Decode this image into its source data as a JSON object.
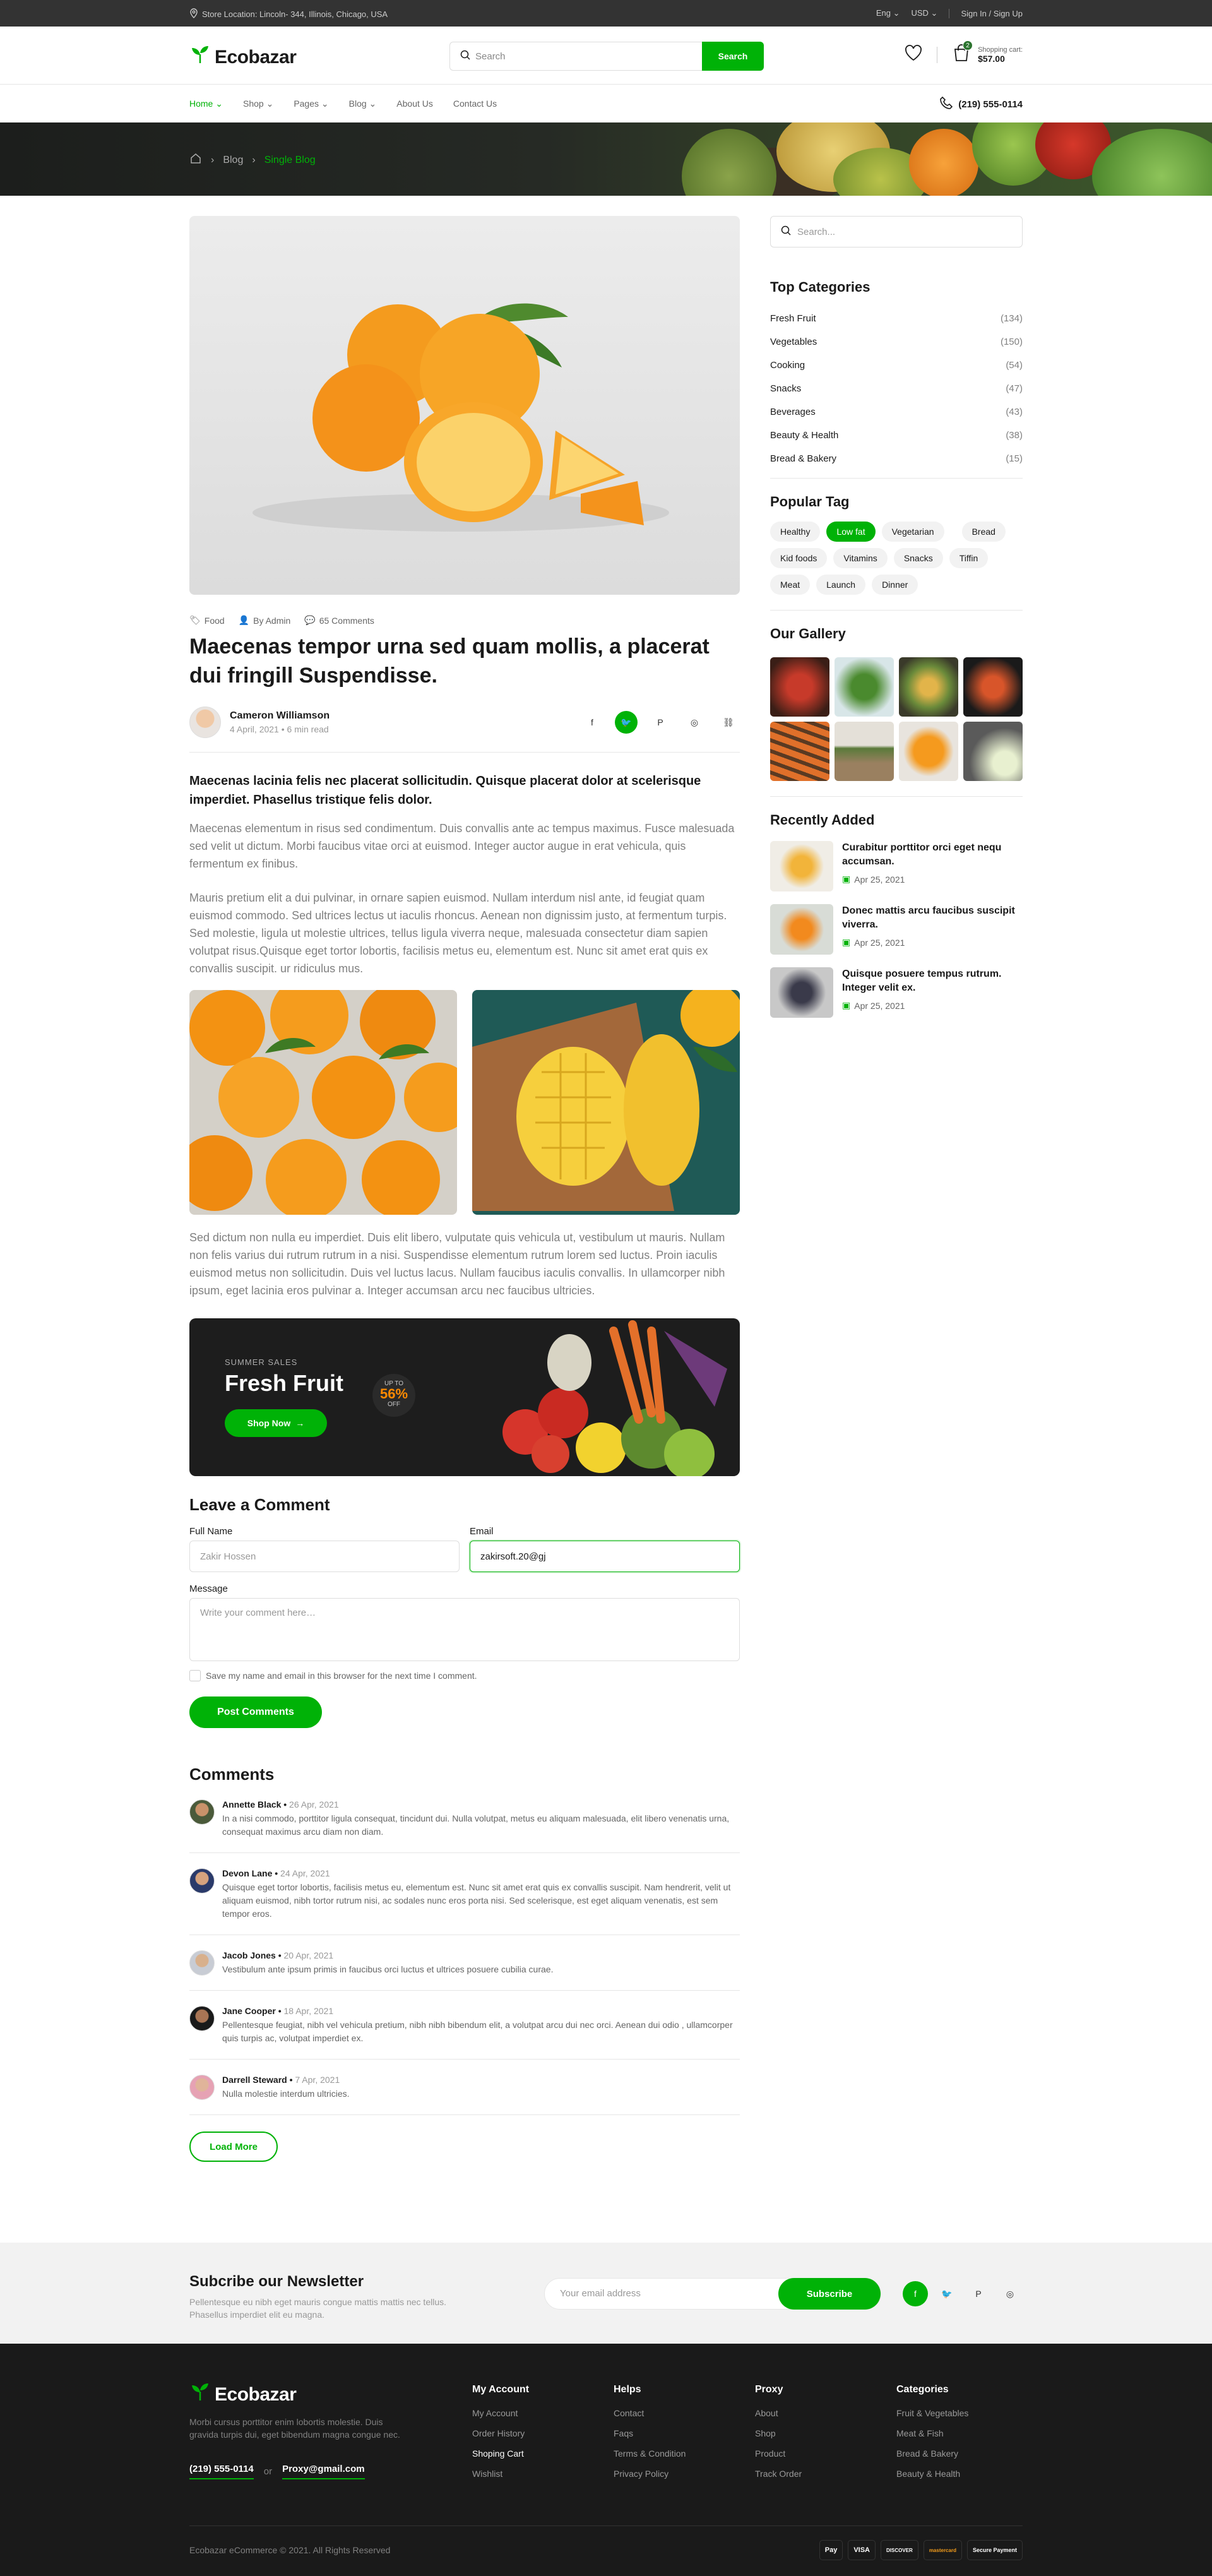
{
  "topbar": {
    "location": "Store Location: Lincoln- 344, Illinois, Chicago, USA",
    "lang": "Eng",
    "currency": "USD",
    "auth": "Sign In / Sign Up"
  },
  "header": {
    "logo": "Ecobazar",
    "search_placeholder": "Search",
    "search_button": "Search",
    "cart_label": "Shopping cart:",
    "cart_value": "$57.00",
    "cart_count": "2"
  },
  "nav": {
    "items": [
      "Home",
      "Shop",
      "Pages",
      "Blog",
      "About Us",
      "Contact Us"
    ],
    "phone": "(219) 555-0114"
  },
  "breadcrumb": {
    "items": [
      "Blog",
      "Single Blog"
    ]
  },
  "post": {
    "category": "Food",
    "author_meta": "By Admin",
    "comments_count": "65 Comments",
    "title": "Maecenas tempor urna sed quam mollis, a placerat dui fringill Suspendisse.",
    "author": "Cameron Williamson",
    "date": "4 April, 2021",
    "read_time": "6 min read",
    "lead": "Maecenas lacinia felis nec placerat sollicitudin. Quisque placerat dolor at scelerisque imperdiet. Phasellus tristique felis dolor.",
    "para1": "Maecenas elementum in risus sed condimentum. Duis convallis ante ac tempus maximus. Fusce malesuada sed velit ut dictum. Morbi faucibus vitae orci at euismod. Integer auctor augue in erat vehicula, quis fermentum ex finibus.",
    "para2": "Mauris pretium elit a dui pulvinar, in ornare sapien euismod. Nullam interdum nisl ante, id feugiat quam euismod commodo. Sed ultrices lectus ut iaculis rhoncus. Aenean non dignissim justo, at fermentum turpis. Sed molestie, ligula ut molestie ultrices, tellus ligula viverra neque, malesuada consectetur diam sapien volutpat risus.Quisque eget tortor lobortis, facilisis metus eu, elementum est. Nunc sit amet erat quis ex convallis suscipit. ur ridiculus mus.",
    "para3": "Sed dictum non nulla eu imperdiet. Duis elit libero, vulputate quis vehicula ut, vestibulum ut mauris. Nullam non felis varius dui rutrum rutrum in a nisi. Suspendisse elementum rutrum lorem sed luctus. Proin iaculis euismod metus non sollicitudin. Duis vel luctus lacus. Nullam faucibus iaculis convallis. In ullamcorper nibh ipsum, eget lacinia eros pulvinar a. Integer accumsan arcu nec faucibus ultricies."
  },
  "promo": {
    "subtitle": "SUMMER SALES",
    "title": "Fresh Fruit",
    "button": "Shop Now",
    "up_to": "UP TO",
    "percent": "56%",
    "off": "OFF"
  },
  "comment_form": {
    "title": "Leave a Comment",
    "name_label": "Full Name",
    "name_value": "Zakir Hossen",
    "email_label": "Email",
    "email_value": "zakirsoft.20@gj",
    "message_label": "Message",
    "message_placeholder": "Write your comment here…",
    "checkbox_label": "Save my name and email in this browser for the next time I comment.",
    "submit": "Post Comments"
  },
  "comments": {
    "title": "Comments",
    "items": [
      {
        "name": "Annette Black",
        "date": "26 Apr, 2021",
        "text": "In a nisi commodo, porttitor ligula consequat, tincidunt dui. Nulla volutpat, metus eu aliquam malesuada, elit libero venenatis urna, consequat maximus arcu diam non diam."
      },
      {
        "name": "Devon Lane",
        "date": "24 Apr, 2021",
        "text": "Quisque eget tortor lobortis, facilisis metus eu, elementum est. Nunc sit amet erat quis ex convallis suscipit. Nam hendrerit, velit ut aliquam euismod, nibh tortor rutrum nisi, ac sodales nunc eros porta nisi. Sed scelerisque, est eget aliquam venenatis, est sem tempor eros."
      },
      {
        "name": "Jacob Jones",
        "date": "20 Apr, 2021",
        "text": "Vestibulum ante ipsum primis in faucibus orci luctus et ultrices posuere cubilia curae."
      },
      {
        "name": "Jane Cooper",
        "date": "18 Apr, 2021",
        "text": "Pellentesque feugiat, nibh vel vehicula pretium, nibh nibh bibendum elit, a volutpat arcu dui nec orci. Aenean dui odio , ullamcorper quis turpis ac, volutpat imperdiet ex."
      },
      {
        "name": "Darrell Steward",
        "date": "7 Apr, 2021",
        "text": "Nulla molestie interdum ultricies."
      }
    ],
    "load_more": "Load More"
  },
  "sidebar": {
    "search_placeholder": "Search...",
    "categories_title": "Top Categories",
    "categories": [
      {
        "name": "Fresh Fruit",
        "count": "(134)"
      },
      {
        "name": "Vegetables",
        "count": "(150)"
      },
      {
        "name": "Cooking",
        "count": "(54)"
      },
      {
        "name": "Snacks",
        "count": "(47)"
      },
      {
        "name": "Beverages",
        "count": "(43)"
      },
      {
        "name": "Beauty & Health",
        "count": "(38)"
      },
      {
        "name": "Bread & Bakery",
        "count": "(15)"
      }
    ],
    "tags_title": "Popular Tag",
    "tags": [
      "Healthy",
      "Low fat",
      "Vegetarian",
      "Bread",
      "Kid foods",
      "Vitamins",
      "Snacks",
      "Tiffin",
      "Meat",
      "Launch",
      "Dinner"
    ],
    "gallery_title": "Our Gallery",
    "recent_title": "Recently Added",
    "recent": [
      {
        "title": "Curabitur porttitor orci eget nequ accumsan.",
        "date": "Apr 25, 2021"
      },
      {
        "title": "Donec mattis arcu faucibus suscipit viverra.",
        "date": "Apr 25, 2021"
      },
      {
        "title": "Quisque posuere tempus rutrum. Integer velit ex.",
        "date": "Apr 25, 2021"
      }
    ]
  },
  "newsletter": {
    "title": "Subcribe our Newsletter",
    "desc": "Pellentesque eu nibh eget mauris congue mattis mattis nec tellus. Phasellus imperdiet elit eu magna.",
    "placeholder": "Your email address",
    "button": "Subscribe"
  },
  "footer": {
    "logo": "Ecobazar",
    "desc": "Morbi cursus porttitor enim lobortis molestie. Duis gravida turpis dui, eget bibendum magna congue nec.",
    "phone": "(219) 555-0114",
    "or": "or",
    "email": "Proxy@gmail.com",
    "columns": [
      {
        "title": "My Account",
        "links": [
          "My Account",
          "Order History",
          "Shoping Cart",
          "Wishlist"
        ]
      },
      {
        "title": "Helps",
        "links": [
          "Contact",
          "Faqs",
          "Terms & Condition",
          "Privacy Policy"
        ]
      },
      {
        "title": "Proxy",
        "links": [
          "About",
          "Shop",
          "Product",
          "Track Order"
        ]
      },
      {
        "title": "Categories",
        "links": [
          "Fruit & Vegetables",
          "Meat & Fish",
          "Bread & Bakery",
          "Beauty & Health"
        ]
      }
    ],
    "copyright": "Ecobazar eCommerce © 2021. All Rights Reserved",
    "payments": [
      "Pay",
      "VISA",
      "DISCOVER",
      "mastercard",
      "Secure Payment"
    ]
  },
  "colors": {
    "accent": "#00b207",
    "dark": "#1a1a1a",
    "topbar": "#333333"
  }
}
